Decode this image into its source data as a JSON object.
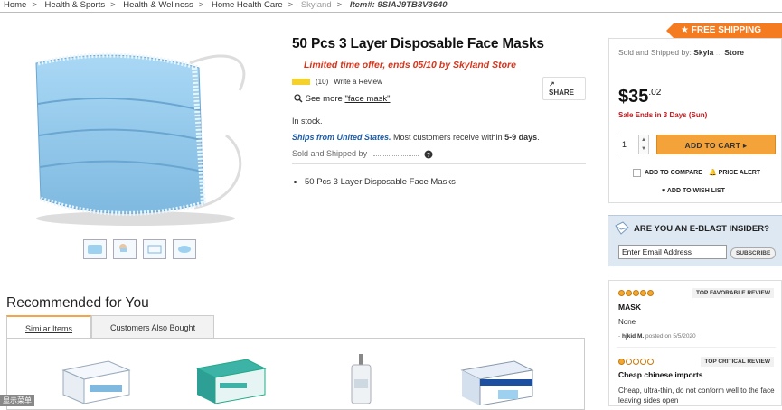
{
  "breadcrumb": {
    "items": [
      "Home",
      "Health & Sports",
      "Health & Wellness",
      "Home Health Care",
      "Skyland"
    ],
    "item_number": "Item#: 9SIAJ9TB8V3640"
  },
  "gallery": {
    "thumbnail_count": 4
  },
  "product": {
    "title": "50 Pcs 3 Layer Disposable Face Masks",
    "offer": "Limited time offer, ends 05/10 by Skyland Store",
    "review_count": "(10)",
    "write_review": "Write a Review",
    "share": "SHARE",
    "see_more_prefix": "See more ",
    "see_more_link": "\"face mask\"",
    "stock": "In stock.",
    "ships_from": "Ships from United States.",
    "delivery_prefix": " Most customers receive within ",
    "delivery_days": "5-9 days",
    "delivery_suffix": ".",
    "sold_by_label": "Sold and Shipped by",
    "bullets": [
      "50 Pcs 3 Layer Disposable Face Masks"
    ]
  },
  "buy_box": {
    "free_shipping": "FREE SHIPPING",
    "sold_label": "Sold and Shipped by:",
    "seller_partial": "Skyla",
    "seller_suffix": "Store",
    "price_dollars": "$35",
    "price_cents": ".02",
    "sale_ends": "Sale Ends in 3 Days (Sun)",
    "quantity": "1",
    "add_to_cart": "ADD TO CART",
    "add_to_compare": "ADD TO COMPARE",
    "price_alert": "PRICE ALERT",
    "wish_list": "ADD TO WISH LIST"
  },
  "eblast": {
    "title": "ARE YOU AN E-BLAST INSIDER?",
    "email_value": "Enter Email Address",
    "subscribe": "SUBSCRIBE"
  },
  "reviews": {
    "favorable": {
      "label": "TOP FAVORABLE REVIEW",
      "stars": 5,
      "title": "MASK",
      "body": "None",
      "author": "hjkid M.",
      "posted": "posted on 5/5/2020"
    },
    "critical": {
      "label": "TOP CRITICAL REVIEW",
      "stars": 1,
      "title": "Cheap chinese imports",
      "body": "Cheap, ultra-thin, do not conform well to the face leaving sides open"
    }
  },
  "recommended": {
    "heading": "Recommended for You",
    "tabs": [
      "Similar Items",
      "Customers Also Bought"
    ]
  },
  "footer": {
    "badge": "显示菜单"
  },
  "colors": {
    "accent_orange": "#f47b20",
    "cart_button": "#f4a23a",
    "offer_red": "#d9331a",
    "mask_blue": "#9ed0ef"
  }
}
